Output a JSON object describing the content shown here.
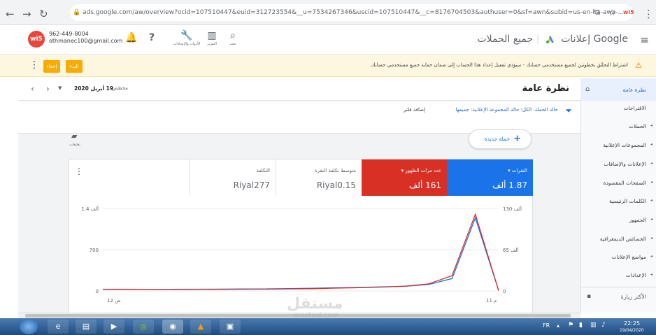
{
  "browser": {
    "url": "ads.google.com/aw/overview?ocid=107510447&euid=312723554&__u=7534267346&uscid=107510447&__c=8176704503&authuser=0&sf=awn&subid=us-en-ha-awa-...",
    "ext_badge": "wi5"
  },
  "header": {
    "account_phone": "962-449-8004",
    "account_email": "othmanec100@gmail.com",
    "avatar_text": "wi5",
    "tools_label": "الأدوات والإعدادات",
    "reports_label": "التقرير",
    "search_label": "بحث",
    "product_name": "Google إعلانات",
    "section_title": "جميع الحملات"
  },
  "banner": {
    "message": "اشتراط التحقّق بخطوتين لجميع مستخدمي حسابك - سيؤدي تفعيل إعداد هذا الحساب إلى ضمان حماية جميع مستخدمي حسابك.",
    "start_button": "البدء",
    "dismiss_button": "إخفاء"
  },
  "sidebar": {
    "items": [
      {
        "label": "نظرة عامة",
        "active": true
      },
      {
        "label": "الاقتراحات"
      },
      {
        "label": "الحملات"
      },
      {
        "label": "المجموعات الإعلانية"
      },
      {
        "label": "الإعلانات والإضافات"
      },
      {
        "label": "الصفحات المقصودة"
      },
      {
        "label": "الكلمات الرئيسية"
      },
      {
        "label": "الجمهور"
      },
      {
        "label": "الخصائص الديمغرافية"
      },
      {
        "label": "مواضع الإعلانات"
      },
      {
        "label": "الإعدادات"
      }
    ],
    "more_label": "الأكثر زيارة"
  },
  "page": {
    "title": "نظرة عامة",
    "date_mode": "مخصّص",
    "date_value": "19 أبريل 2020",
    "filter_text": "حالة الحملة: الكل؛ حالة المجموعة الإعلانية: جميعها",
    "add_filter": "إضافة فلتر",
    "new_campaign": "حملة جديدة",
    "notes_label": "تعليقات"
  },
  "metrics": [
    {
      "label": "النقرات",
      "value": "1.87 ألف",
      "color": "#1a73e8"
    },
    {
      "label": "عدد مرات الظهور",
      "value": "161 ألف",
      "color": "#d93025"
    },
    {
      "label": "متوسط تكلفة النقرة",
      "value": "Riyal0.15",
      "color": "#ffffff"
    },
    {
      "label": "التكلفة",
      "value": "Riyal277",
      "color": "#ffffff"
    }
  ],
  "chart_data": {
    "type": "line",
    "left_axis": {
      "ticks": [
        "0",
        "700",
        "1.4 ألف"
      ],
      "range": [
        0,
        1400
      ]
    },
    "right_axis": {
      "ticks": [
        "0",
        "65 ألف",
        "130 ألف"
      ],
      "range": [
        0,
        130
      ]
    },
    "x_ticks": [
      "12 ص",
      "11 م"
    ],
    "series": [
      {
        "color": "#1a73e8",
        "values": [
          30,
          30,
          29,
          28,
          30,
          31,
          33,
          35,
          40,
          45,
          55,
          60,
          70,
          80,
          110,
          210,
          1240,
          5
        ]
      },
      {
        "color": "#d93025",
        "values": [
          25,
          26,
          25,
          24,
          25,
          26,
          28,
          30,
          34,
          38,
          47,
          55,
          65,
          82,
          120,
          260,
          1300,
          5
        ]
      }
    ]
  },
  "taskbar": {
    "lang": "FR",
    "time": "22:25",
    "date": "19/04/2020"
  },
  "watermark": {
    "text": "مستقل",
    "sub": "mostaql.com"
  }
}
